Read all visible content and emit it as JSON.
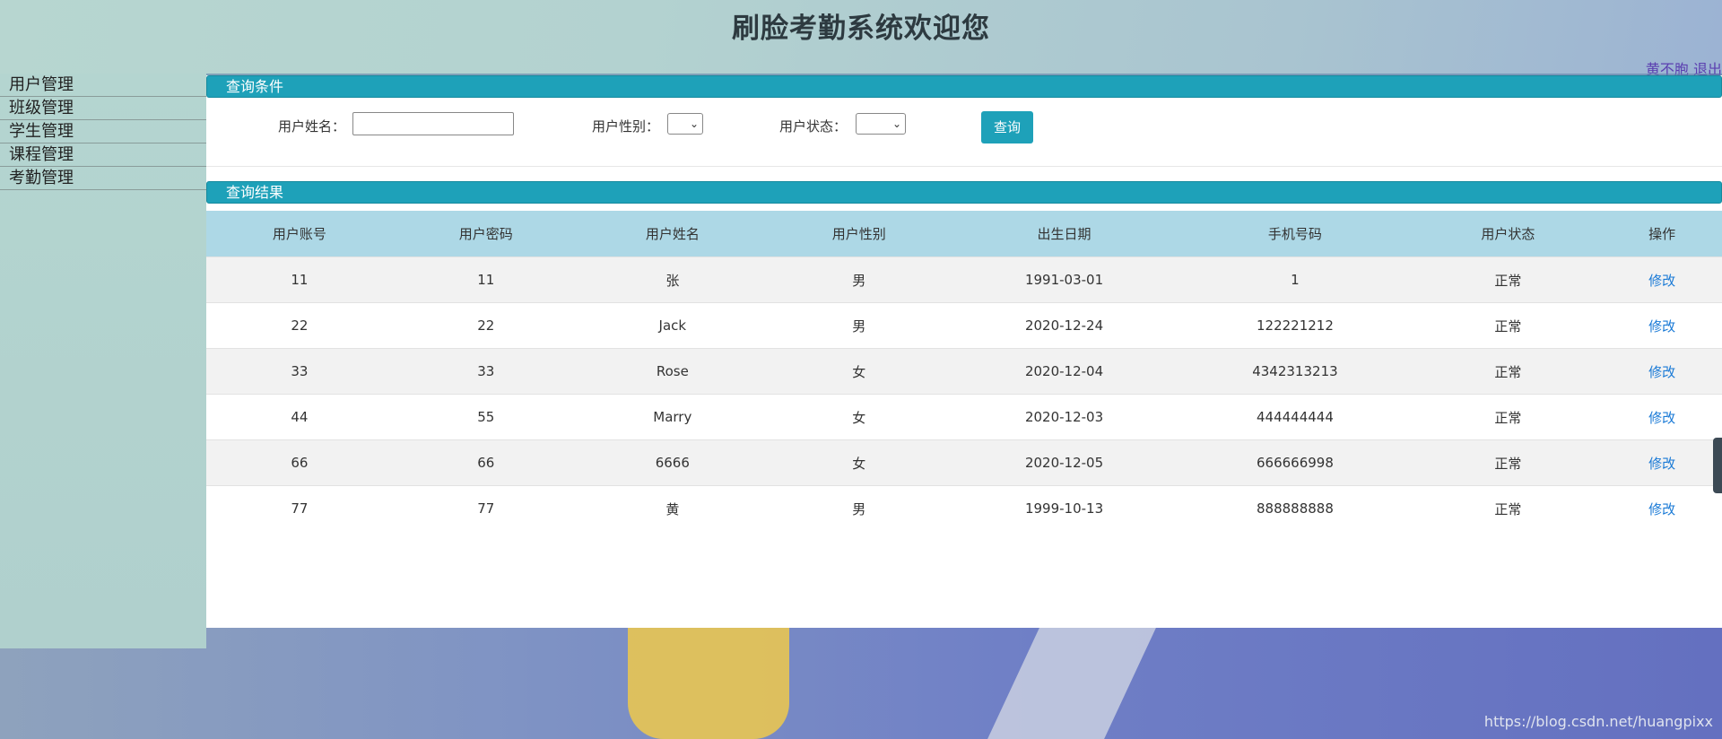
{
  "header": {
    "title": "刷脸考勤系统欢迎您"
  },
  "user_links": {
    "username": "黄不胞",
    "logout": "退出"
  },
  "sidebar": {
    "items": [
      {
        "label": "用户管理"
      },
      {
        "label": "班级管理"
      },
      {
        "label": "学生管理"
      },
      {
        "label": "课程管理"
      },
      {
        "label": "考勤管理"
      }
    ]
  },
  "query": {
    "section_title": "查询条件",
    "name_label": "用户姓名：",
    "name_value": "",
    "gender_label": "用户性别：",
    "gender_value": "",
    "status_label": "用户状态：",
    "status_value": "",
    "button_label": "查询"
  },
  "results": {
    "section_title": "查询结果",
    "columns": [
      "用户账号",
      "用户密码",
      "用户姓名",
      "用户性别",
      "出生日期",
      "手机号码",
      "用户状态",
      "操作"
    ],
    "rows": [
      {
        "account": "11",
        "password": "11",
        "name": "张",
        "gender": "男",
        "birth": "1991-03-01",
        "phone": "1",
        "status": "正常",
        "action": "修改"
      },
      {
        "account": "22",
        "password": "22",
        "name": "Jack",
        "gender": "男",
        "birth": "2020-12-24",
        "phone": "122221212",
        "status": "正常",
        "action": "修改"
      },
      {
        "account": "33",
        "password": "33",
        "name": "Rose",
        "gender": "女",
        "birth": "2020-12-04",
        "phone": "4342313213",
        "status": "正常",
        "action": "修改"
      },
      {
        "account": "44",
        "password": "55",
        "name": "Marry",
        "gender": "女",
        "birth": "2020-12-03",
        "phone": "444444444",
        "status": "正常",
        "action": "修改"
      },
      {
        "account": "66",
        "password": "66",
        "name": "6666",
        "gender": "女",
        "birth": "2020-12-05",
        "phone": "666666998",
        "status": "正常",
        "action": "修改"
      },
      {
        "account": "77",
        "password": "77",
        "name": "黄",
        "gender": "男",
        "birth": "1999-10-13",
        "phone": "888888888",
        "status": "正常",
        "action": "修改"
      }
    ]
  },
  "watermark": "https://blog.csdn.net/huangpixx",
  "colors": {
    "accent": "#1ea1b9",
    "header_row": "#add8e6",
    "link": "#1a7ad6"
  }
}
